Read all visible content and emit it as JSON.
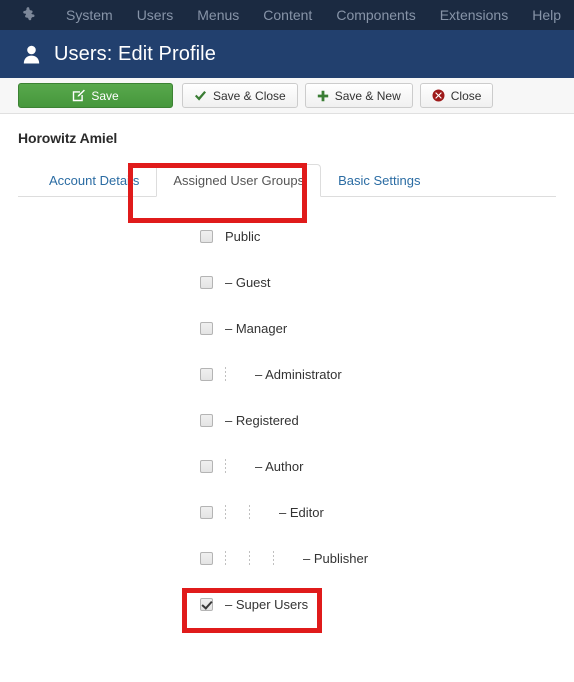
{
  "topnav": {
    "logo_icon": "joomla-logo-icon",
    "items": [
      {
        "label": "System"
      },
      {
        "label": "Users"
      },
      {
        "label": "Menus"
      },
      {
        "label": "Content"
      },
      {
        "label": "Components"
      },
      {
        "label": "Extensions"
      },
      {
        "label": "Help"
      }
    ]
  },
  "pageheader": {
    "icon": "user-icon",
    "title": "Users: Edit Profile"
  },
  "toolbar": {
    "save_label": "Save",
    "save_icon": "edit-square-icon",
    "save_close_label": "Save & Close",
    "save_close_icon": "checkmark-icon",
    "save_new_label": "Save & New",
    "save_new_icon": "plus-icon",
    "close_label": "Close",
    "close_icon": "close-circle-icon"
  },
  "record": {
    "name": "Horowitz Amiel"
  },
  "tabs": [
    {
      "label": "Account Details",
      "active": false
    },
    {
      "label": "Assigned User Groups",
      "active": true
    },
    {
      "label": "Basic Settings",
      "active": false
    }
  ],
  "user_groups": [
    {
      "label": "Public",
      "level": 0,
      "checked": false
    },
    {
      "label": "– Guest",
      "level": 0,
      "checked": false
    },
    {
      "label": "– Manager",
      "level": 0,
      "checked": false
    },
    {
      "label": "– Administrator",
      "level": 1,
      "checked": false
    },
    {
      "label": "– Registered",
      "level": 0,
      "checked": false
    },
    {
      "label": "– Author",
      "level": 1,
      "checked": false
    },
    {
      "label": "– Editor",
      "level": 2,
      "checked": false
    },
    {
      "label": "– Publisher",
      "level": 3,
      "checked": false
    },
    {
      "label": "– Super Users",
      "level": 0,
      "checked": true
    }
  ],
  "highlights": {
    "tab_color": "#e01b1b",
    "super_users_color": "#e01b1b"
  },
  "colors": {
    "topnav_bg": "#1b2a41",
    "header_bg": "#22406e",
    "save_green": "#46973c",
    "tab_link": "#2b6ca3",
    "highlight_red": "#e01b1b"
  }
}
